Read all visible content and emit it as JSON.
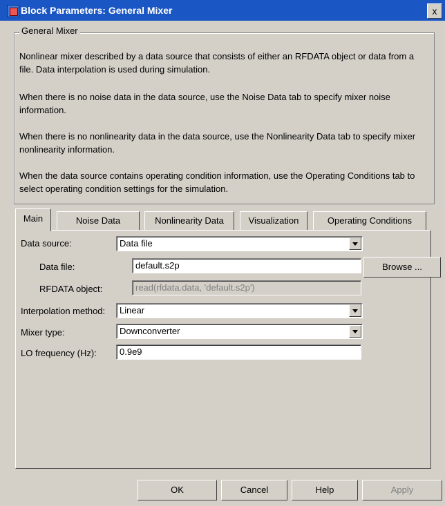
{
  "window": {
    "title": "Block Parameters: General Mixer",
    "close_glyph": "x"
  },
  "group": {
    "title": "General Mixer",
    "paragraphs": [
      "Nonlinear mixer described by a data source that consists of either an RFDATA object or data from a file. Data interpolation is used during simulation.",
      "When there is no noise data in the data source, use the Noise Data tab to specify mixer noise information.",
      "When there is no nonlinearity data in the data source, use the Nonlinearity Data tab to specify mixer nonlinearity information.",
      "When the data source contains operating condition information, use the Operating Conditions tab to select operating condition settings for the simulation."
    ]
  },
  "tabs": [
    "Main",
    "Noise Data",
    "Nonlinearity Data",
    "Visualization",
    "Operating Conditions"
  ],
  "main": {
    "data_source": {
      "label": "Data source:",
      "value": "Data file"
    },
    "data_file": {
      "label": "Data file:",
      "value": "default.s2p"
    },
    "rfdata": {
      "label": "RFDATA object:",
      "value": "read(rfdata.data, 'default.s2p')"
    },
    "interp": {
      "label": "Interpolation method:",
      "value": "Linear"
    },
    "mixer": {
      "label": "Mixer type:",
      "value": "Downconverter"
    },
    "lo": {
      "label": "LO frequency (Hz):",
      "value": "0.9e9"
    },
    "browse_label": "Browse ..."
  },
  "buttons": {
    "ok": "OK",
    "cancel": "Cancel",
    "help": "Help",
    "apply": "Apply"
  }
}
